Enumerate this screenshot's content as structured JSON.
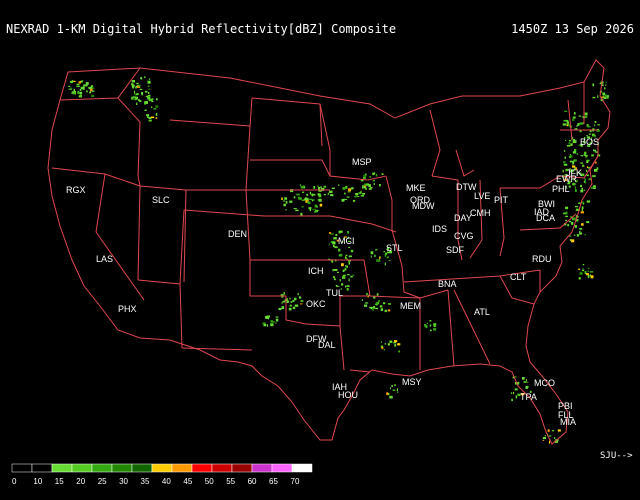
{
  "header": {
    "title": "NEXRAD 1-KM Digital Hybrid Reflectivity[dBZ] Composite",
    "timestamp": "1450Z 13 Sep 2026"
  },
  "nav": {
    "label": "SJU-->"
  },
  "colors": {
    "background": "#000000",
    "borders": "#e0474f",
    "text": "#ffffff"
  },
  "legend": {
    "ticks": [
      "0",
      "10",
      "15",
      "20",
      "25",
      "30",
      "35",
      "40",
      "45",
      "50",
      "55",
      "60",
      "65",
      "70"
    ],
    "swatches": [
      "#000000",
      "#000000",
      "#66dd33",
      "#55cc22",
      "#33aa11",
      "#228800",
      "#116600",
      "#ffcc00",
      "#ff9900",
      "#ff0000",
      "#cc0000",
      "#990000",
      "#cc33cc",
      "#ff66ff",
      "#ffffff"
    ]
  },
  "stations": [
    "RGX",
    "SLC",
    "DEN",
    "LAS",
    "PHX",
    "MSP",
    "MKE",
    "ORD",
    "MDW",
    "DTW",
    "LVE",
    "PIT",
    "DAY",
    "CMH",
    "CVG",
    "IDS",
    "SDF",
    "STL",
    "MCI",
    "ICH",
    "TUL",
    "OKC",
    "DFW",
    "DAL",
    "IAH",
    "HOU",
    "MSY",
    "MEM",
    "BNA",
    "ATL",
    "CLT",
    "RDU",
    "BOS",
    "JFK",
    "EWR",
    "PHL",
    "BWI",
    "IAD",
    "DCA",
    "MCO",
    "TPA",
    "PBI",
    "FLL",
    "MIA"
  ]
}
